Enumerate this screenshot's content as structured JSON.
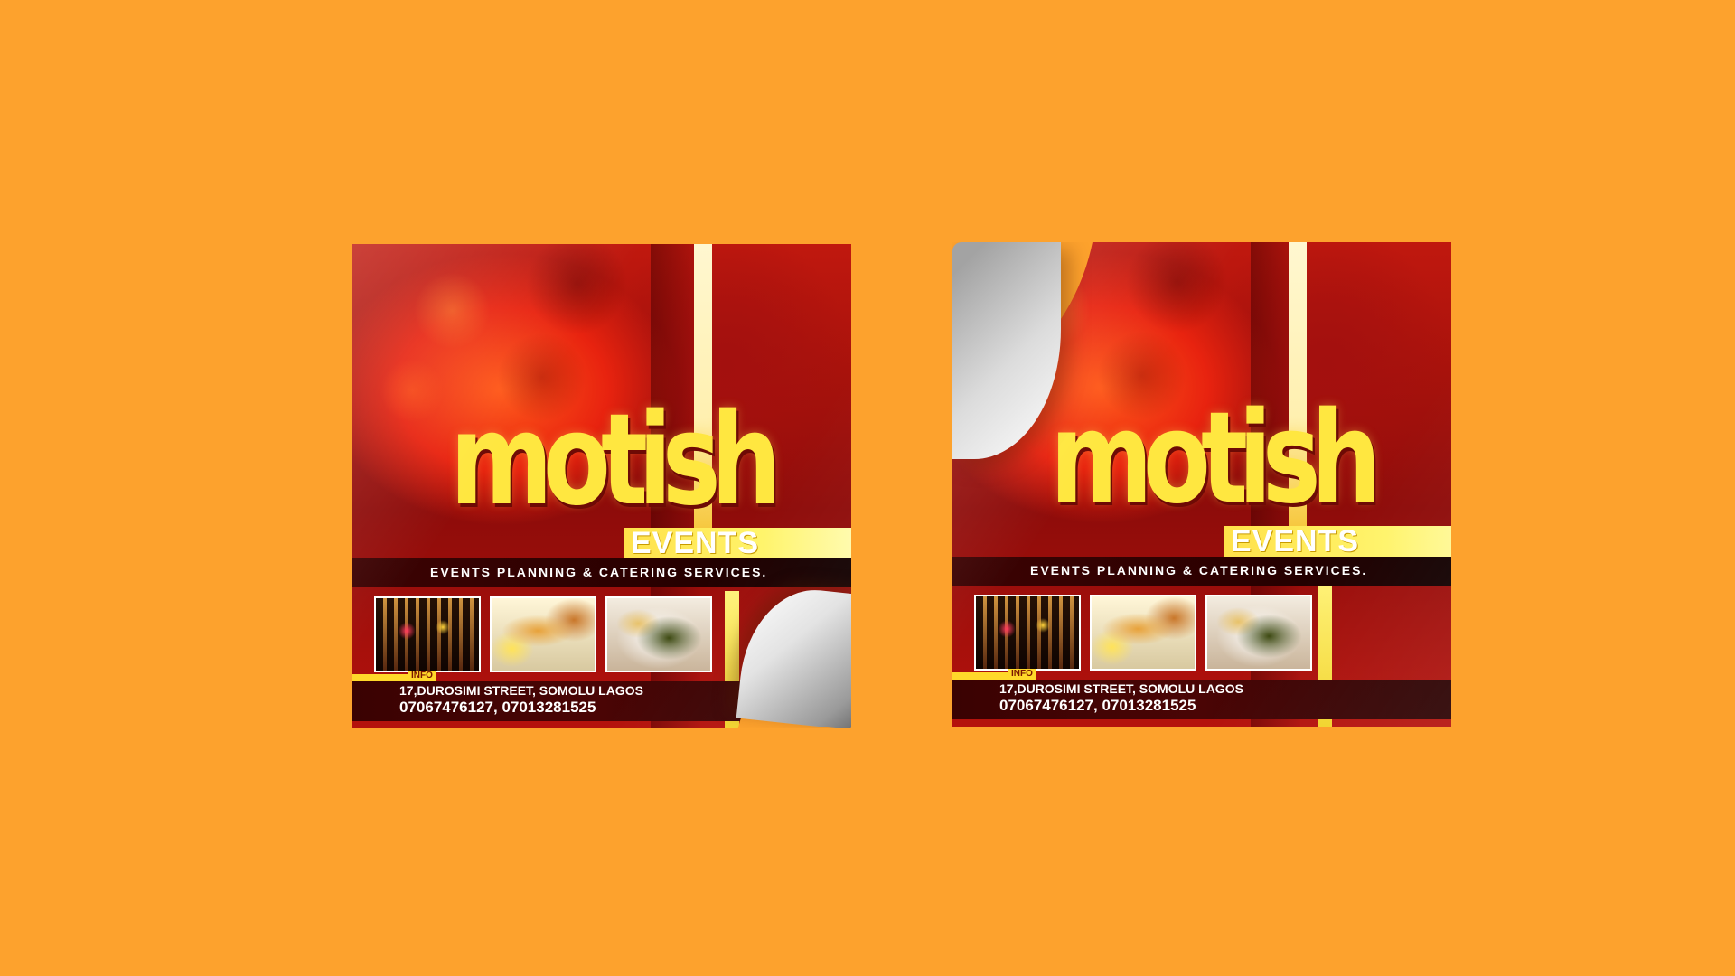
{
  "background_color": "#fda22d",
  "stickers": [
    {
      "brand": "motish",
      "sub_brand": "EVENTS",
      "tagline": "EVENTS PLANNING & CATERING SERVICES.",
      "info_label": "INFO",
      "address": "17,DUROSIMI STREET, SOMOLU LAGOS",
      "phones": "07067476127, 07013281525",
      "peel": "bottom-right"
    },
    {
      "brand": "motish",
      "sub_brand": "EVENTS",
      "tagline": "EVENTS PLANNING & CATERING SERVICES.",
      "info_label": "INFO",
      "address": "17,DUROSIMI STREET, SOMOLU LAGOS",
      "phones": "07067476127, 07013281525",
      "peel": "top-left"
    }
  ],
  "colors": {
    "accent_yellow": "#ffe740",
    "deep_red": "#8e0c0a"
  }
}
